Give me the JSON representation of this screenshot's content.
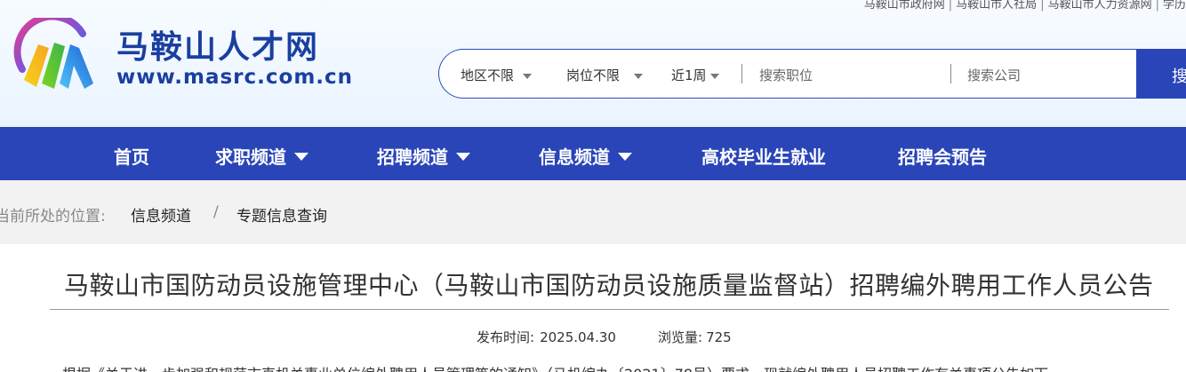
{
  "top_links": {
    "items": [
      "马鞍山市政府网",
      "马鞍山市人社局",
      "马鞍山市人力资源网",
      "学历"
    ],
    "separator": "|"
  },
  "site": {
    "name": "马鞍山人才网",
    "url": "www.masrc.com.cn",
    "colors": {
      "primary": "#2a45b8",
      "logo_text": "#1a3fa0"
    }
  },
  "search": {
    "filters": [
      "地区不限",
      "岗位不限",
      "近1周"
    ],
    "job_placeholder": "搜索职位",
    "company_placeholder": "搜索公司",
    "button_label": "搜索"
  },
  "nav": {
    "items": [
      {
        "label": "首页",
        "dropdown": false
      },
      {
        "label": "求职频道",
        "dropdown": true
      },
      {
        "label": "招聘频道",
        "dropdown": true
      },
      {
        "label": "信息频道",
        "dropdown": true
      },
      {
        "label": "高校毕业生就业",
        "dropdown": false
      },
      {
        "label": "招聘会预告",
        "dropdown": false
      }
    ]
  },
  "breadcrumb": {
    "prefix": "当前所处的位置:",
    "items": [
      "信息频道",
      "专题信息查询"
    ],
    "separator": "/"
  },
  "article": {
    "title": "马鞍山市国防动员设施管理中心（马鞍山市国防动员设施质量监督站）招聘编外聘用工作人员公告",
    "publish_label": "发布时间:",
    "publish_date": "2025.04.30",
    "views_label": "浏览量:",
    "views": "725",
    "first_line": "根据《关于进一步加强和规范市直机关事业单位编外聘用人员管理等的通知》（马机编办〔2021〕78号）要求，现就编外聘用人员招聘工作有关事项公告如下"
  }
}
